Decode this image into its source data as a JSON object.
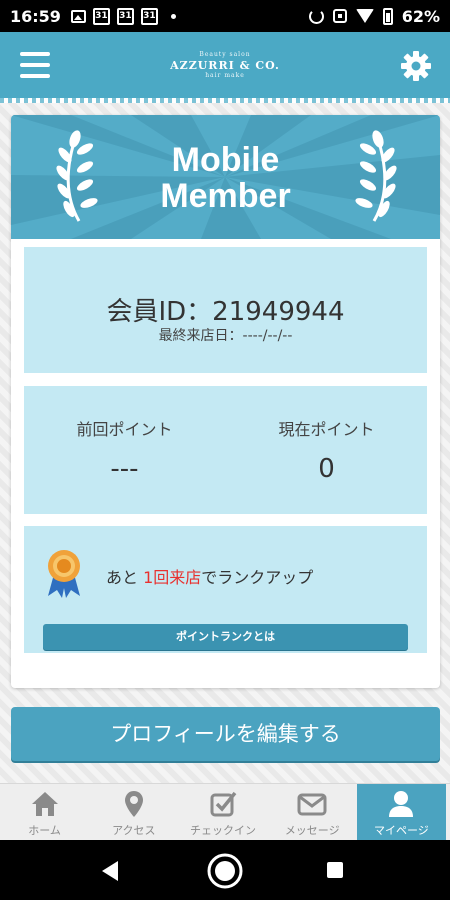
{
  "status_bar": {
    "time": "16:59",
    "calendar_days": [
      "31",
      "31",
      "31"
    ],
    "battery": "62%"
  },
  "header": {
    "logo_sub_top": "Beauty salon",
    "logo_main": "AZZURRI & CO.",
    "logo_sub_bottom": "hair make"
  },
  "card": {
    "banner_title_line1": "Mobile",
    "banner_title_line2": "Member",
    "member_id": "会員ID：21949944",
    "last_visit": "最終来店日：----/--/--",
    "previous_points_label": "前回ポイント",
    "previous_points_value": "---",
    "current_points_label": "現在ポイント",
    "current_points_value": "0",
    "rank_prefix": "あと ",
    "rank_highlight": "1回来店",
    "rank_suffix": "でランクアップ",
    "rank_button": "ポイントランクとは"
  },
  "edit_profile_button": "プロフィールを編集する",
  "tabs": [
    {
      "label": "ホーム",
      "icon": "home-icon",
      "active": false
    },
    {
      "label": "アクセス",
      "icon": "map-pin-icon",
      "active": false
    },
    {
      "label": "チェックイン",
      "icon": "checkbox-icon",
      "active": false
    },
    {
      "label": "メッセージ",
      "icon": "mail-icon",
      "active": false
    },
    {
      "label": "マイページ",
      "icon": "user-icon",
      "active": true
    }
  ],
  "colors": {
    "header": "#4ba9c5",
    "panel": "#c4e9f3",
    "highlight": "#e8312f",
    "tab_active": "#4ba3c0"
  }
}
